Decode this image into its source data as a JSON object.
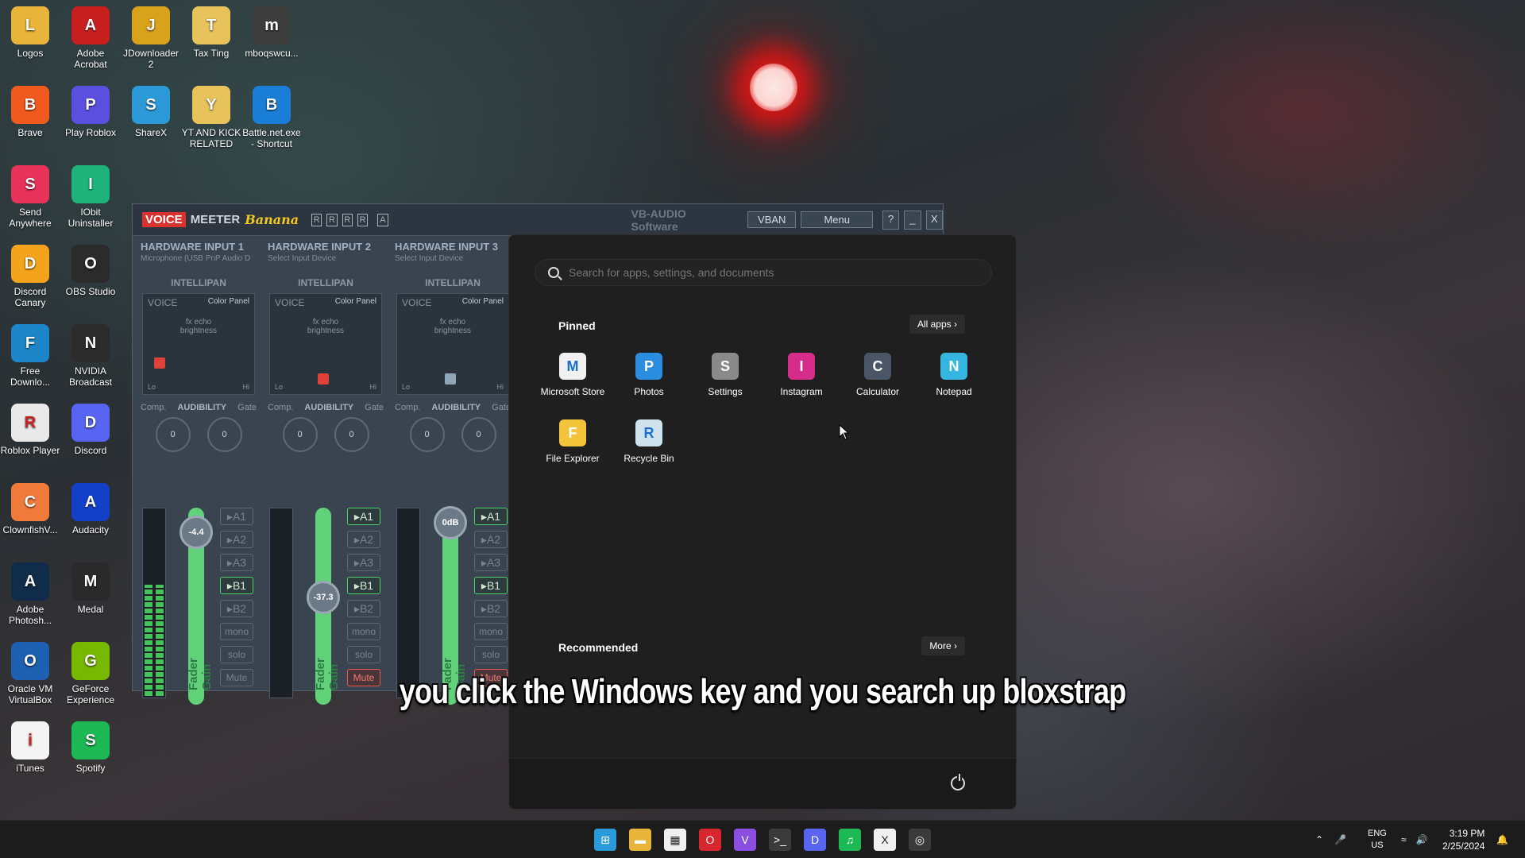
{
  "desktop": {
    "icons": [
      {
        "label": "Logos",
        "icon": "folder-icon",
        "color": "#e8b43a"
      },
      {
        "label": "Adobe Acrobat",
        "icon": "acrobat-icon",
        "color": "#c91f1f"
      },
      {
        "label": "JDownloader 2",
        "icon": "jdownloader-icon",
        "color": "#d9a21b"
      },
      {
        "label": "Tax Ting",
        "icon": "folder-icon",
        "color": "#e8c25a"
      },
      {
        "label": "mboqswcu...",
        "icon": "file-icon",
        "color": "#3c3c3c"
      },
      {
        "label": "Brave",
        "icon": "brave-icon",
        "color": "#f05a1e"
      },
      {
        "label": "Play Roblox",
        "icon": "roblox-icon",
        "color": "#5b4fe0"
      },
      {
        "label": "ShareX",
        "icon": "sharex-icon",
        "color": "#2c9ad8"
      },
      {
        "label": "YT AND KICK RELATED",
        "icon": "folder-icon",
        "color": "#e8c25a"
      },
      {
        "label": "Battle.net.exe - Shortcut",
        "icon": "battlenet-icon",
        "color": "#1a7ed6"
      },
      {
        "label": "Send Anywhere",
        "icon": "send-anywhere-icon",
        "color": "#e8325a"
      },
      {
        "label": "IObit Uninstaller",
        "icon": "iobit-icon",
        "color": "#1db37a"
      },
      {
        "label": "Discord Canary",
        "icon": "discord-canary-icon",
        "color": "#f3a31c"
      },
      {
        "label": "OBS Studio",
        "icon": "obs-icon",
        "color": "#2b2b2b"
      },
      {
        "label": "Free Downlo...",
        "icon": "free-download-icon",
        "color": "#1c86c8"
      },
      {
        "label": "NVIDIA Broadcast",
        "icon": "nvidia-broadcast-icon",
        "color": "#2b2b2b"
      },
      {
        "label": "Roblox Player",
        "icon": "roblox-player-icon",
        "color": "#e9e9e9"
      },
      {
        "label": "Discord",
        "icon": "discord-icon",
        "color": "#5865f2"
      },
      {
        "label": "ClownfishV...",
        "icon": "clownfish-icon",
        "color": "#f07a3a"
      },
      {
        "label": "Audacity",
        "icon": "audacity-icon",
        "color": "#1340c8"
      },
      {
        "label": "Adobe Photosh...",
        "icon": "photoshop-icon",
        "color": "#0f2c4a"
      },
      {
        "label": "Medal",
        "icon": "medal-icon",
        "color": "#2a2a2a"
      },
      {
        "label": "Oracle VM VirtualBox",
        "icon": "virtualbox-icon",
        "color": "#1d5fb0"
      },
      {
        "label": "GeForce Experience",
        "icon": "geforce-icon",
        "color": "#76b900"
      },
      {
        "label": "iTunes",
        "icon": "itunes-icon",
        "color": "#f4f4f4"
      },
      {
        "label": "Spotify",
        "icon": "spotify-icon",
        "color": "#1db954"
      }
    ]
  },
  "voicemeeter": {
    "brand_voice": "VOICE",
    "brand_meeter": "MEETER",
    "brand_banana": "Banana",
    "r_badges": [
      "R",
      "R",
      "R",
      "R",
      "A"
    ],
    "vban": "VBAN",
    "menu": "Menu",
    "help": "?",
    "minimize": "_",
    "close": "X",
    "vendor": "VB-AUDIO Software",
    "strips": [
      {
        "title": "HARDWARE INPUT 1",
        "device": "Microphone (USB PnP Audio D",
        "pan_color": "#e0423a",
        "fader_value": "-4.4",
        "a1": false,
        "b1": true,
        "mute": false
      },
      {
        "title": "HARDWARE INPUT 2",
        "device": "Select Input Device",
        "pan_color": "#e0423a",
        "fader_value": "-37.3",
        "a1": true,
        "b1": true,
        "mute": true
      },
      {
        "title": "HARDWARE INPUT 3",
        "device": "Select Input Device",
        "pan_color": "#8fa6b8",
        "fader_value": "0dB",
        "a1": true,
        "b1": true,
        "mute": true
      }
    ],
    "labels": {
      "intellipan": "INTELLIPAN",
      "voice": "VOICE",
      "color_panel": "Color Panel",
      "fx_echo": "fx echo",
      "brightness": "brightness",
      "lo": "Lo",
      "hi": "Hi",
      "comp": "Comp.",
      "audibility": "AUDIBILITY",
      "gate": "Gate",
      "knob_value": "0",
      "fader_gain": "Fader Gain",
      "a1": "A1",
      "a2": "A2",
      "a3": "A3",
      "b1": "B1",
      "b2": "B2",
      "mono": "mono",
      "solo": "solo",
      "mute": "Mute"
    }
  },
  "start_menu": {
    "search_placeholder": "Search for apps, settings, and documents",
    "pinned_title": "Pinned",
    "all_apps": "All apps",
    "recommended_title": "Recommended",
    "more": "More",
    "pinned": [
      {
        "label": "Microsoft Store",
        "icon": "microsoft-store-icon",
        "color": "#f0f0f0"
      },
      {
        "label": "Photos",
        "icon": "photos-icon",
        "color": "#2a8de0"
      },
      {
        "label": "Settings",
        "icon": "settings-icon",
        "color": "#8a8a8a"
      },
      {
        "label": "Instagram",
        "icon": "instagram-icon",
        "color": "#d62d8a"
      },
      {
        "label": "Calculator",
        "icon": "calculator-icon",
        "color": "#4a5566"
      },
      {
        "label": "Notepad",
        "icon": "notepad-icon",
        "color": "#35b6e0"
      },
      {
        "label": "File Explorer",
        "icon": "file-explorer-icon",
        "color": "#f3c33a"
      },
      {
        "label": "Recycle Bin",
        "icon": "recycle-bin-icon",
        "color": "#cfe3ef"
      }
    ]
  },
  "caption": "you click the Windows key and you search up bloxstrap",
  "taskbar": {
    "apps": [
      "start-icon",
      "file-explorer-icon",
      "calendar-icon",
      "opera-icon",
      "vpn-icon",
      "terminal-icon",
      "discord-icon",
      "spotify-icon",
      "capcut-icon",
      "obs-icon"
    ],
    "lang_top": "ENG",
    "lang_bottom": "US",
    "time": "3:19 PM",
    "date": "2/25/2024"
  }
}
